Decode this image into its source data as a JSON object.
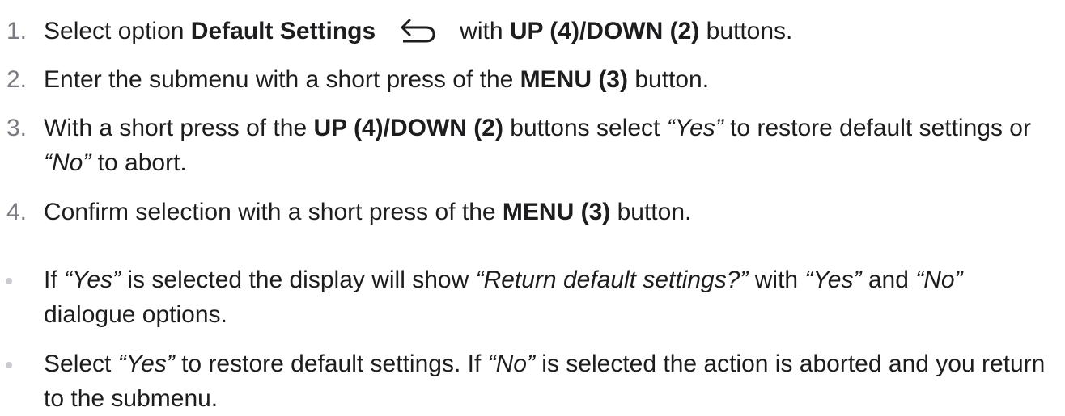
{
  "steps": [
    {
      "number": "1.",
      "t1": "Select option ",
      "b1": "Default Settings",
      "icon": "return-arrow-icon",
      "t2": "with ",
      "b2": "UP (4)/DOWN (2)",
      "t3": " buttons."
    },
    {
      "number": "2.",
      "t1": "Enter the submenu with a short press of the ",
      "b1": "MENU (3)",
      "t2": " button."
    },
    {
      "number": "3.",
      "t1": "With a short press of the ",
      "b1": "UP (4)/DOWN (2)",
      "t2": " buttons select ",
      "i1": "“Yes”",
      "t3": " to restore default settings or ",
      "i2": "“No”",
      "t4": " to abort."
    },
    {
      "number": "4.",
      "t1": "Confirm selection with a short press of the ",
      "b1": "MENU (3)",
      "t2": " button."
    }
  ],
  "notes": [
    {
      "t1": "If ",
      "i1": "“Yes”",
      "t2": " is selected the display will show ",
      "i2": "“Return default settings?”",
      "t3": " with ",
      "i3": "“Yes”",
      "t4": " and ",
      "i4": "“No”",
      "t5": " dialogue options."
    },
    {
      "t1": "Select ",
      "i1": "“Yes”",
      "t2": " to restore default settings. If ",
      "i2": "“No”",
      "t3": " is selected the action is aborted and you return to the submenu."
    }
  ]
}
